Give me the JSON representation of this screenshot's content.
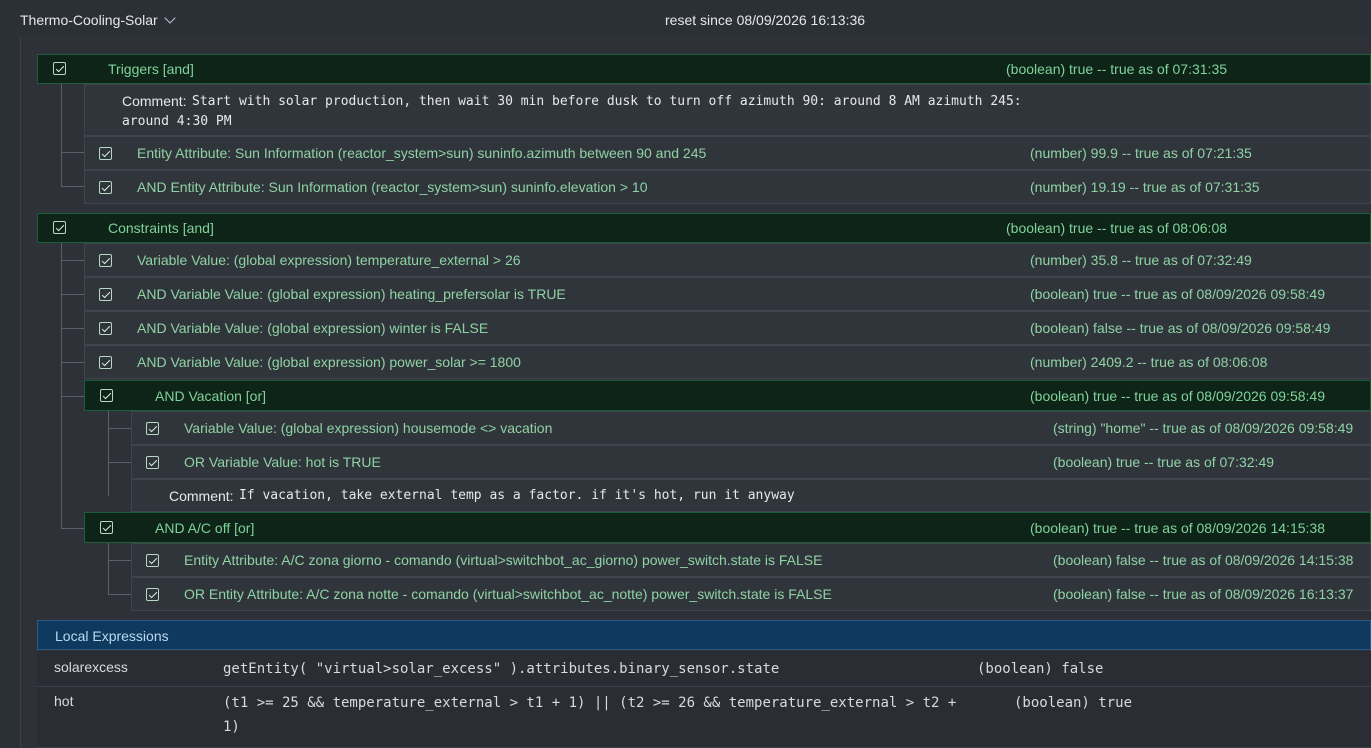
{
  "header": {
    "title": "Thermo-Cooling-Solar",
    "reset": "reset since 08/09/2026 16:13:36"
  },
  "triggers": {
    "label": "Triggers [and]",
    "status": "(boolean) true -- true as of 07:31:35",
    "comment_label": "Comment:",
    "comment_line1": "Start with solar production, then wait 30 min before dusk to turn off azimuth 90: around 8 AM azimuth 245:",
    "comment_line2": "around 4:30 PM",
    "items": [
      {
        "label": "Entity Attribute: Sun Information (reactor_system>sun) suninfo.azimuth between 90 and 245",
        "status": "(number) 99.9 -- true as of 07:21:35"
      },
      {
        "label": "AND Entity Attribute: Sun Information (reactor_system>sun) suninfo.elevation > 10",
        "status": "(number) 19.19 -- true as of 07:31:35"
      }
    ]
  },
  "constraints": {
    "label": "Constraints [and]",
    "status": "(boolean) true -- true as of 08:06:08",
    "items": [
      {
        "label": "Variable Value: (global expression) temperature_external > 26",
        "status": "(number) 35.8 -- true as of 07:32:49"
      },
      {
        "label": "AND Variable Value: (global expression) heating_prefersolar is TRUE",
        "status": "(boolean) true -- true as of 08/09/2026 09:58:49"
      },
      {
        "label": "AND Variable Value: (global expression) winter is FALSE",
        "status": "(boolean) false -- true as of 08/09/2026 09:58:49"
      },
      {
        "label": "AND Variable Value: (global expression) power_solar >= 1800",
        "status": "(number) 2409.2 -- true as of 08:06:08"
      }
    ],
    "vacation": {
      "label": "AND Vacation [or]",
      "status": "(boolean) true -- true as of 08/09/2026 09:58:49",
      "items": [
        {
          "label": "Variable Value: (global expression) housemode <> vacation",
          "status": "(string) \"home\" -- true as of 08/09/2026 09:58:49"
        },
        {
          "label": "OR Variable Value: hot is TRUE",
          "status": "(boolean) true -- true as of 07:32:49"
        }
      ],
      "comment_label": "Comment:",
      "comment": "If vacation, take external temp as a factor. if it's hot, run it anyway"
    },
    "ac_off": {
      "label": "AND A/C off [or]",
      "status": "(boolean) true -- true as of 08/09/2026 14:15:38",
      "items": [
        {
          "label": "Entity Attribute: A/C zona giorno - comando (virtual>switchbot_ac_giorno) power_switch.state is FALSE",
          "status": "(boolean) false -- true as of 08/09/2026 14:15:38"
        },
        {
          "label": "OR Entity Attribute: A/C zona notte - comando (virtual>switchbot_ac_notte) power_switch.state is FALSE",
          "status": "(boolean) false -- true as of 08/09/2026 16:13:37"
        }
      ]
    }
  },
  "local_expressions": {
    "title": "Local Expressions",
    "rows": [
      {
        "name": "solarexcess",
        "expr_line1": "getEntity( \"virtual>solar_excess\" ).attributes.binary_sensor.state",
        "expr_line2": "",
        "value": "(boolean) false"
      },
      {
        "name": "hot",
        "expr_line1": "(t1 >= 25 && temperature_external > t1 + 1) || (t2 >= 26 && temperature_external > t2 +",
        "expr_line2": "1)",
        "value": "(boolean) true"
      }
    ]
  }
}
